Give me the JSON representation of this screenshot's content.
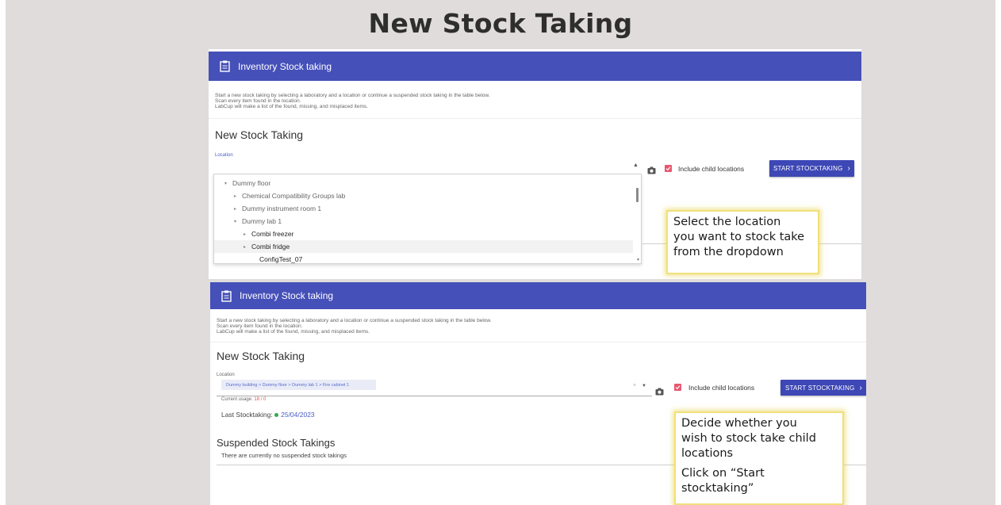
{
  "slide": {
    "title": "New Stock Taking"
  },
  "shot1": {
    "appbar_title": "Inventory Stock taking",
    "info_lines": [
      "Start a new stock taking by selecting a laboratory and a location or continue a suspended stock taking in the table below.",
      "Scan every item found in the location.",
      "LabCup will make a list of the found, missing, and misplaced items."
    ],
    "heading": "New Stock Taking",
    "location_label": "Location",
    "include_child_label": "Include child locations",
    "start_button": "START STOCKTAKING",
    "dropdown_items": [
      {
        "label": "Dummy floor",
        "arrow": "▾"
      },
      {
        "label": "Chemical Compatibility Groups lab",
        "arrow": "▸"
      },
      {
        "label": "Dummy instrument room 1",
        "arrow": "▸"
      },
      {
        "label": "Dummy lab 1",
        "arrow": "▾"
      },
      {
        "label": "Combi freezer",
        "arrow": "▸"
      },
      {
        "label": "Combi fridge",
        "arrow": "▸"
      },
      {
        "label": "ConfigTest_07",
        "arrow": ""
      }
    ],
    "callout": [
      "Select the location",
      "you want to stock take",
      "from the dropdown"
    ]
  },
  "shot2": {
    "appbar_title": "Inventory Stock taking",
    "info_lines": [
      "Start a new stock taking by selecting a laboratory and a location or continue a suspended stock taking in the table below.",
      "Scan every item found in the location.",
      "LabCup will make a list of the found, missing, and misplaced items."
    ],
    "heading": "New Stock Taking",
    "location_label": "Location",
    "location_value": "Dummy building > Dummy floor > Dummy lab 1 > Fire cabinet 1",
    "current_usage_label": "Current usage:",
    "current_usage_value": "18 / 0",
    "last_stocktaking_label": "Last Stocktaking:",
    "last_stocktaking_date": "25/04/2023",
    "include_child_label": "Include child locations",
    "start_button": "START STOCKTAKING",
    "suspended_heading": "Suspended Stock Takings",
    "suspended_empty": "There are currently no suspended stock takings",
    "callout": [
      "Decide whether you",
      "wish to stock take child",
      "locations",
      "Click on “Start",
      "stocktaking”"
    ]
  },
  "colors": {
    "appbar": "#4550b8",
    "button": "#3d47b5",
    "checkbox": "#e8576e",
    "callout_border": "#f0e07a"
  }
}
